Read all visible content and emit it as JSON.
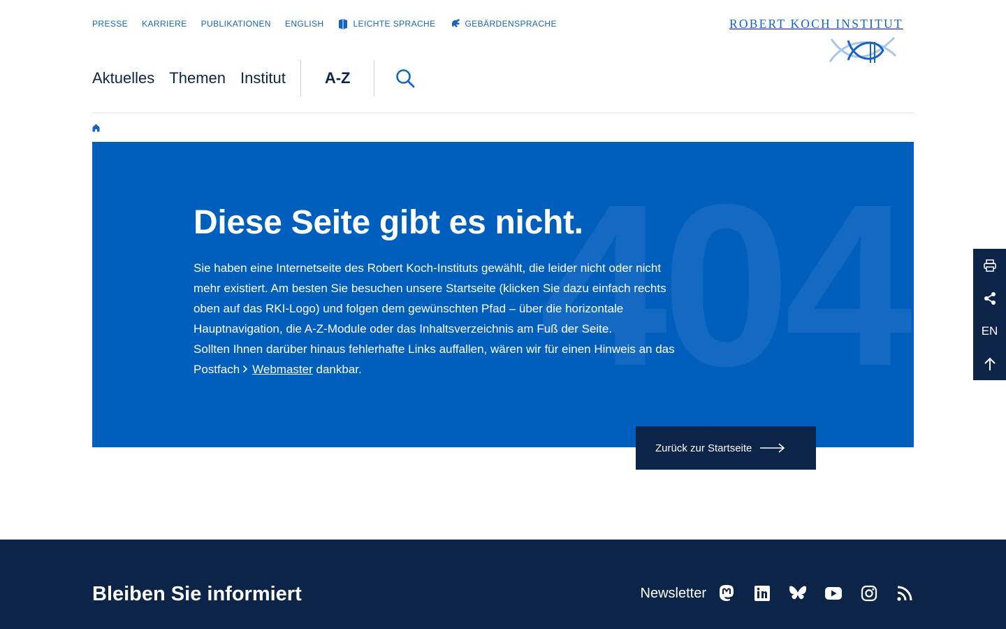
{
  "top_links": [
    {
      "label": "PRESSE"
    },
    {
      "label": "KARRIERE"
    },
    {
      "label": "PUBLIKATIONEN"
    },
    {
      "label": "ENGLISH"
    },
    {
      "label": "LEICHTE SPRACHE",
      "icon": "book-icon"
    },
    {
      "label": "GEBÄRDENSPRACHE",
      "icon": "sign-language-icon"
    }
  ],
  "logo": {
    "text": "ROBERT KOCH INSTITUT"
  },
  "main_nav": {
    "items": [
      {
        "label": "Aktuelles"
      },
      {
        "label": "Themen"
      },
      {
        "label": "Institut"
      }
    ],
    "az_label": "A-Z",
    "search_icon": "search-icon"
  },
  "breadcrumb": {
    "icon": "home-icon"
  },
  "hero": {
    "background_number": "404",
    "title": "Diese Seite gibt es nicht.",
    "paragraph1": "Sie haben eine Internetseite des Robert Koch-Instituts gewählt, die leider nicht oder nicht mehr existiert. Am besten Sie besuchen unsere Startseite (klicken Sie dazu einfach rechts oben auf das RKI-Logo) und folgen dem gewünschten Pfad – über die horizontale Hauptnavigation, die A-Z-Module oder das Inhaltsverzeichnis am Fuß der Seite.",
    "paragraph2_before": "Sollten Ihnen darüber hinaus fehlerhafte Links auffallen, wären wir für einen Hinweis an das Postfach",
    "link_label": "Webmaster",
    "paragraph2_after": "dankbar."
  },
  "home_button": {
    "label": "Zurück zur Startseite"
  },
  "side_tools": {
    "print_icon": "printer-icon",
    "share_icon": "share-icon",
    "language_label": "EN",
    "top_icon": "arrow-up-icon"
  },
  "footer": {
    "heading": "Bleiben Sie informiert",
    "newsletter_label": "Newsletter",
    "social_icons": [
      "mastodon-icon",
      "linkedin-icon",
      "bluesky-icon",
      "youtube-icon",
      "instagram-icon",
      "rss-icon"
    ]
  },
  "colors": {
    "brand_blue": "#005ebd",
    "link_blue": "#1565c0",
    "navy": "#0c2447"
  }
}
